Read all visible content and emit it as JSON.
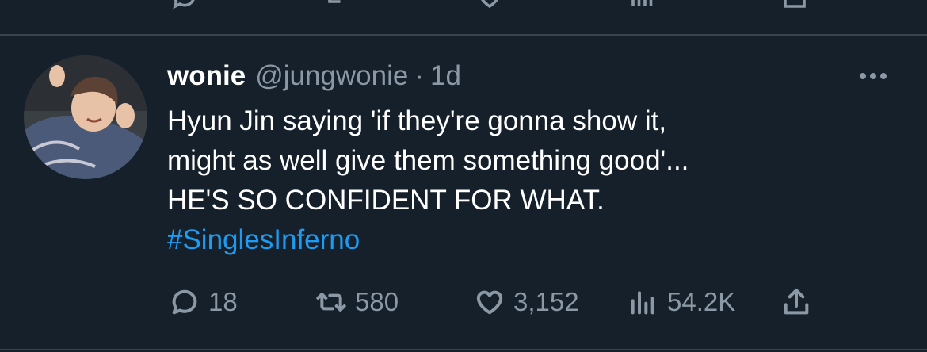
{
  "tweet": {
    "display_name": "wonie",
    "handle": "@jungwonie",
    "separator": "·",
    "time": "1d",
    "lines": [
      "Hyun Jin saying 'if they're gonna show it,",
      "might as well give them something good'...",
      "HE'S SO CONFIDENT FOR WHAT."
    ],
    "hashtag": "#SinglesInferno",
    "stats": {
      "replies": "18",
      "retweets": "580",
      "likes": "3,152",
      "views": "54.2K"
    }
  },
  "icons": {
    "reply": "reply-icon",
    "retweet": "retweet-icon",
    "like": "heart-icon",
    "views": "views-icon",
    "share": "share-icon",
    "more": "more-icon"
  },
  "colors": {
    "background": "#15202b",
    "secondary_text": "#8b98a5",
    "link": "#1d9bf0",
    "divider": "#38444d"
  }
}
